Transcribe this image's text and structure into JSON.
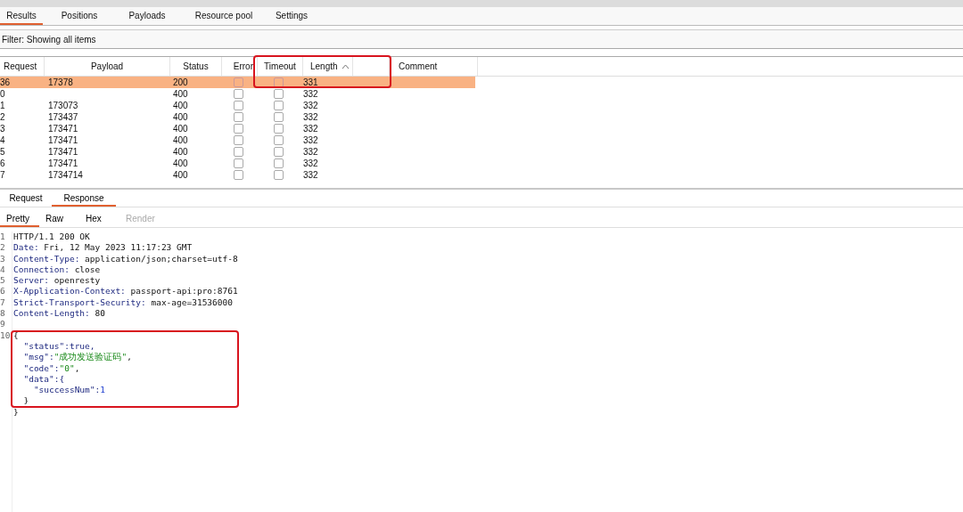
{
  "tabs": [
    {
      "label": "Results",
      "selected": true
    },
    {
      "label": "Positions",
      "selected": false
    },
    {
      "label": "Payloads",
      "selected": false
    },
    {
      "label": "Resource pool",
      "selected": false
    },
    {
      "label": "Settings",
      "selected": false
    }
  ],
  "filter": "Filter: Showing all items",
  "table": {
    "columns": [
      "Request",
      "Payload",
      "Status",
      "Error",
      "Timeout",
      "Length",
      "Comment"
    ],
    "rows": [
      {
        "request": "36",
        "payload": "17378",
        "status": "200",
        "error": false,
        "timeout": false,
        "length": "331",
        "selected": true
      },
      {
        "request": "0",
        "payload": "",
        "status": "400",
        "error": false,
        "timeout": false,
        "length": "332",
        "selected": false
      },
      {
        "request": "1",
        "payload": "173073",
        "status": "400",
        "error": false,
        "timeout": false,
        "length": "332",
        "selected": false
      },
      {
        "request": "2",
        "payload": "173437",
        "status": "400",
        "error": false,
        "timeout": false,
        "length": "332",
        "selected": false
      },
      {
        "request": "3",
        "payload": "173471",
        "status": "400",
        "error": false,
        "timeout": false,
        "length": "332",
        "selected": false
      },
      {
        "request": "4",
        "payload": "173471",
        "status": "400",
        "error": false,
        "timeout": false,
        "length": "332",
        "selected": false
      },
      {
        "request": "5",
        "payload": "173471",
        "status": "400",
        "error": false,
        "timeout": false,
        "length": "332",
        "selected": false
      },
      {
        "request": "6",
        "payload": "173471",
        "status": "400",
        "error": false,
        "timeout": false,
        "length": "332",
        "selected": false
      },
      {
        "request": "7",
        "payload": "1734714",
        "status": "400",
        "error": false,
        "timeout": false,
        "length": "332",
        "selected": false
      }
    ]
  },
  "message_tabs": [
    {
      "label": "Request",
      "selected": false
    },
    {
      "label": "Response",
      "selected": true
    }
  ],
  "view_tabs": [
    {
      "label": "Pretty",
      "selected": true,
      "disabled": false
    },
    {
      "label": "Raw",
      "selected": false,
      "disabled": false
    },
    {
      "label": "Hex",
      "selected": false,
      "disabled": false
    },
    {
      "label": "Render",
      "selected": false,
      "disabled": true
    }
  ],
  "response_lines": [
    {
      "number": "1",
      "segments": [
        {
          "text": "HTTP/1.1 200 OK",
          "kind": "plain"
        }
      ]
    },
    {
      "number": "2",
      "segments": [
        {
          "text": "Date:",
          "kind": "name"
        },
        {
          "text": " Fri, 12 May 2023 11:17:23 GMT",
          "kind": "plain"
        }
      ]
    },
    {
      "number": "3",
      "segments": [
        {
          "text": "Content-Type:",
          "kind": "name"
        },
        {
          "text": " application/json;charset=utf-8",
          "kind": "plain"
        }
      ]
    },
    {
      "number": "4",
      "segments": [
        {
          "text": "Connection:",
          "kind": "name"
        },
        {
          "text": " close",
          "kind": "plain"
        }
      ]
    },
    {
      "number": "5",
      "segments": [
        {
          "text": "Server:",
          "kind": "name"
        },
        {
          "text": " openresty",
          "kind": "plain"
        }
      ]
    },
    {
      "number": "6",
      "segments": [
        {
          "text": "X-Application-Context:",
          "kind": "name"
        },
        {
          "text": " passport-api:pro:8761",
          "kind": "plain"
        }
      ]
    },
    {
      "number": "7",
      "segments": [
        {
          "text": "Strict-Transport-Security:",
          "kind": "name"
        },
        {
          "text": " max-age=31536000",
          "kind": "plain"
        }
      ]
    },
    {
      "number": "8",
      "segments": [
        {
          "text": "Content-Length:",
          "kind": "name"
        },
        {
          "text": " 80",
          "kind": "plain"
        }
      ]
    },
    {
      "number": "9"
    },
    {
      "number": "10",
      "segments": [
        {
          "text": "{",
          "kind": "plain"
        }
      ]
    },
    {
      "segments": [
        {
          "text": "  \"status\":",
          "kind": "name"
        },
        {
          "text": "true,",
          "kind": "name"
        }
      ]
    },
    {
      "segments": [
        {
          "text": "  \"msg\":",
          "kind": "name"
        },
        {
          "text": "\"成功发送验证码\"",
          "kind": "string"
        },
        {
          "text": ",",
          "kind": "plain"
        }
      ]
    },
    {
      "segments": [
        {
          "text": "  \"code\":",
          "kind": "name"
        },
        {
          "text": "\"0\"",
          "kind": "string"
        },
        {
          "text": ",",
          "kind": "plain"
        }
      ]
    },
    {
      "segments": [
        {
          "text": "  \"data\":{",
          "kind": "name"
        }
      ]
    },
    {
      "segments": [
        {
          "text": "    \"successNum\":",
          "kind": "name"
        },
        {
          "text": "1",
          "kind": "number"
        }
      ]
    },
    {
      "segments": [
        {
          "text": "  }",
          "kind": "plain"
        }
      ]
    },
    {
      "segments": [
        {
          "text": "}",
          "kind": "plain"
        }
      ]
    }
  ]
}
